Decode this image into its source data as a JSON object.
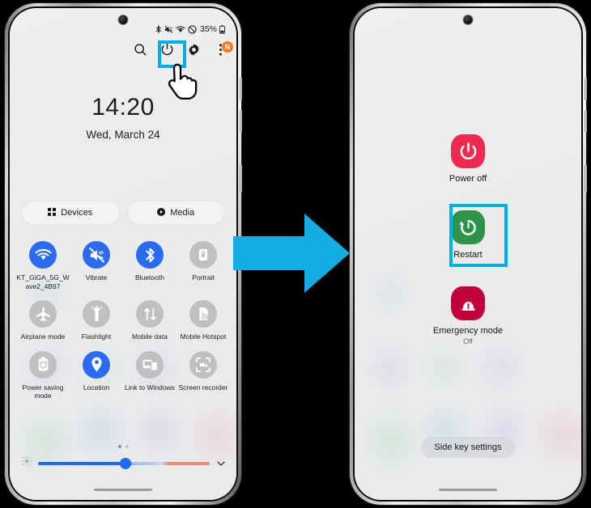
{
  "meta": {
    "background_color": "#000000",
    "highlight_color": "#00aee6",
    "arrow_color": "#13ade4",
    "accent_blue": "#2a6bf2",
    "power_off_color": "#ef2a50",
    "restart_color": "#2e9349",
    "emergency_color": "#c0003c"
  },
  "left_phone": {
    "status_bar": {
      "icons": [
        "bluetooth-icon",
        "vibrate-icon",
        "wifi-icon",
        "do-not-disturb-icon"
      ],
      "battery_percent": "35%",
      "battery_icon": "battery-icon"
    },
    "header_icons": [
      {
        "name": "search-icon",
        "label": "Search"
      },
      {
        "name": "power-icon",
        "label": "Power",
        "highlighted": true
      },
      {
        "name": "gear-icon",
        "label": "Settings"
      },
      {
        "name": "more-options-icon",
        "label": "More options",
        "badge": "N"
      }
    ],
    "clock": {
      "time": "14:20",
      "date": "Wed, March 24"
    },
    "shortcuts": [
      {
        "icon": "devices-grid-icon",
        "label": "Devices"
      },
      {
        "icon": "media-play-icon",
        "label": "Media"
      }
    ],
    "tiles": [
      [
        {
          "icon": "wifi-icon",
          "label": "KT_GiGA_5G_Wave2_4B97",
          "state": "on"
        },
        {
          "icon": "vibrate-icon",
          "label": "Vibrate",
          "state": "on"
        },
        {
          "icon": "bluetooth-icon",
          "label": "Bluetooth",
          "state": "on"
        },
        {
          "icon": "portrait-lock-icon",
          "label": "Portrait",
          "state": "off"
        }
      ],
      [
        {
          "icon": "airplane-icon",
          "label": "Airplane mode",
          "state": "off"
        },
        {
          "icon": "flashlight-icon",
          "label": "Flashlight",
          "state": "off"
        },
        {
          "icon": "mobile-data-icon",
          "label": "Mobile data",
          "state": "off"
        },
        {
          "icon": "mobile-hotspot-icon",
          "label": "Mobile Hotspot",
          "state": "off"
        }
      ],
      [
        {
          "icon": "power-saving-icon",
          "label": "Power saving mode",
          "state": "off"
        },
        {
          "icon": "location-pin-icon",
          "label": "Location",
          "state": "on"
        },
        {
          "icon": "link-to-windows-icon",
          "label": "Link to Windows",
          "state": "off"
        },
        {
          "icon": "screen-recorder-icon",
          "label": "Screen recorder",
          "state": "off"
        }
      ]
    ],
    "page_dots": {
      "count": 2,
      "active_index": 0
    },
    "brightness": {
      "icon": "brightness-icon",
      "value_percent": 51,
      "expand_icon": "chevron-down-icon"
    }
  },
  "right_phone": {
    "menu": [
      {
        "id": "power-off",
        "label": "Power off",
        "sub": "",
        "icon": "power-icon",
        "color": "#ef2a50",
        "highlighted": false
      },
      {
        "id": "restart",
        "label": "Restart",
        "sub": "",
        "icon": "restart-icon",
        "color": "#2e9349",
        "highlighted": true
      },
      {
        "id": "emergency-mode",
        "label": "Emergency mode",
        "sub": "Off",
        "icon": "emergency-icon",
        "color": "#c0003c",
        "highlighted": false
      }
    ],
    "side_key_settings": "Side key settings"
  }
}
